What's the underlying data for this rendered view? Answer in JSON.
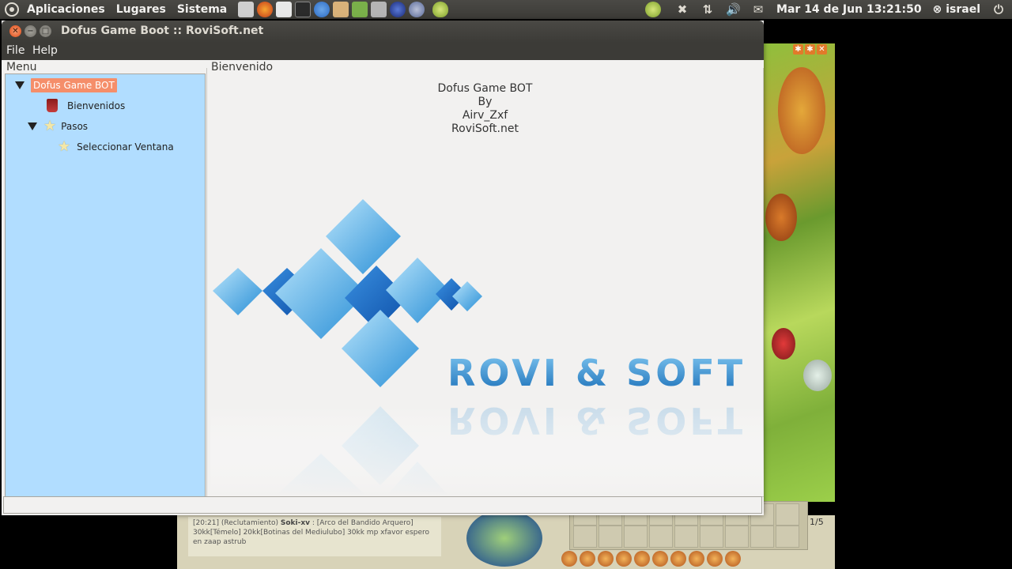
{
  "top_panel": {
    "menus": [
      "Aplicaciones",
      "Lugares",
      "Sistema"
    ],
    "clock": "Mar 14 de Jun 13:21:50",
    "user": "israel"
  },
  "window": {
    "title": "Dofus Game Boot :: RoviSoft.net",
    "menubar": {
      "file": "File",
      "help": "Help"
    },
    "left_panel": {
      "title": "Menu",
      "tree": {
        "root": "Dofus Game BOT",
        "bienvenidos": "Bienvenidos",
        "pasos": "Pasos",
        "seleccionar": "Seleccionar Ventana"
      }
    },
    "right_panel": {
      "title": "Bienvenido",
      "credits": [
        "Dofus Game BOT",
        "By",
        "Airv_Zxf",
        "RoviSoft.net"
      ],
      "logo_text": "ROVI & SOFT"
    }
  },
  "game": {
    "chat_time": "[20:21]",
    "chat_channel": "(Reclutamiento)",
    "chat_name": "Soki-xv",
    "chat_text": ": [Arco del Bandido Arquero] 30kk[Témelo] 20kk[Botinas del Mediulubo] 30kk mp xfavor espero en zaap astrub",
    "page": "1/5"
  },
  "colors": {
    "panel_bg": "#3c3b37",
    "tree_bg": "#b1ddff",
    "selection": "#f58e6a",
    "close_button": "#df4a16",
    "logo_blue": "#1a7fc4"
  }
}
